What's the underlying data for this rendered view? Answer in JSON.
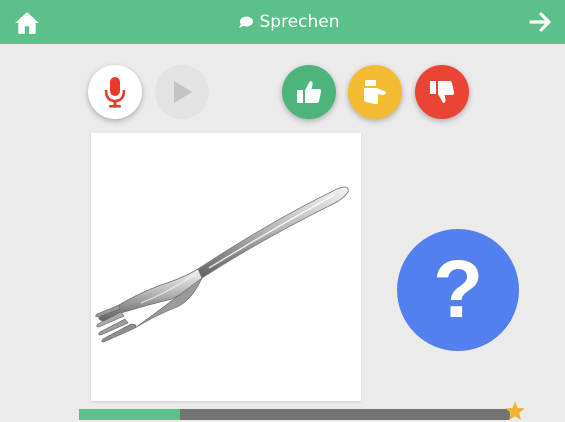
{
  "header": {
    "title": "Sprechen",
    "home_icon": "home-icon",
    "next_icon": "arrow-right-icon",
    "chat_icon": "speech-bubble-icon",
    "background_color": "#5cc08a"
  },
  "controls": {
    "record_icon": "microphone-icon",
    "play_icon": "play-icon",
    "rating": [
      {
        "name": "thumbs-up-icon",
        "color": "#4db57b"
      },
      {
        "name": "thumb-sideways-icon",
        "color": "#f3bb32"
      },
      {
        "name": "thumbs-down-icon",
        "color": "#ea4534"
      }
    ]
  },
  "card": {
    "image": "fork"
  },
  "help": {
    "label": "?",
    "color": "#5480ef"
  },
  "progress": {
    "fraction": 0.235,
    "star_icon": "star-icon"
  }
}
